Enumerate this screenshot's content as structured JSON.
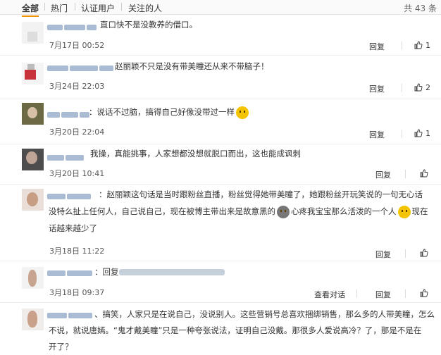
{
  "tabs": [
    {
      "label": "全部"
    },
    {
      "label": "热门"
    },
    {
      "label": "认证用户"
    },
    {
      "label": "关注的人"
    }
  ],
  "total_label": "共 43 条",
  "comments": [
    {
      "text": "直口快不是没教养的借口。",
      "time": "7月17日 00:52",
      "reply": "回复",
      "likes": "1"
    },
    {
      "text": "赵丽颖不只是没有带美瞳还从来不带脑子！",
      "time": "3月24日 22:03",
      "reply": "回复",
      "likes": "2"
    },
    {
      "text": "：说话不过脑，搞得自己好像没带过一样",
      "time": "3月20日 22:04",
      "reply": "回复",
      "likes": "1"
    },
    {
      "text": "我操，真能挑事，人家想都没想就脱口而出，这也能成讽刺",
      "time": "3月20日 10:41",
      "reply": "回复",
      "likes": ""
    },
    {
      "line1": "：赵丽颖这句话是当时跟粉丝直播，粉丝觉得她带美瞳了，她跟粉丝开玩笑说的一句无心话",
      "line2a": "没特么扯上任何人，自己说自己，现在被博主带出来是故意黑的",
      "line2b": "心疼我宝宝那么活泼的一个人",
      "line2c": "现在",
      "line3": "话越来越少了",
      "time": "3月18日 11:22",
      "reply": "回复",
      "likes": ""
    },
    {
      "text": "：回复",
      "time": "3月18日 09:37",
      "view_dialog": "查看对话",
      "reply": "回复",
      "likes": ""
    },
    {
      "line1": "、搞笑，人家只是在说自己，没说别人。这些营销号总喜欢捆绑销售，那么多的人带美瞳，怎么",
      "line2": "不说，就说唐嫣。“鬼才戴美瞳”只是一种夸张说法，证明自己没戴。那很多人爱说高冷？了，那是不是在",
      "line3": "开了？"
    }
  ],
  "colors": {
    "accent": "#f29100",
    "name_blur": "#a9bcd3"
  }
}
